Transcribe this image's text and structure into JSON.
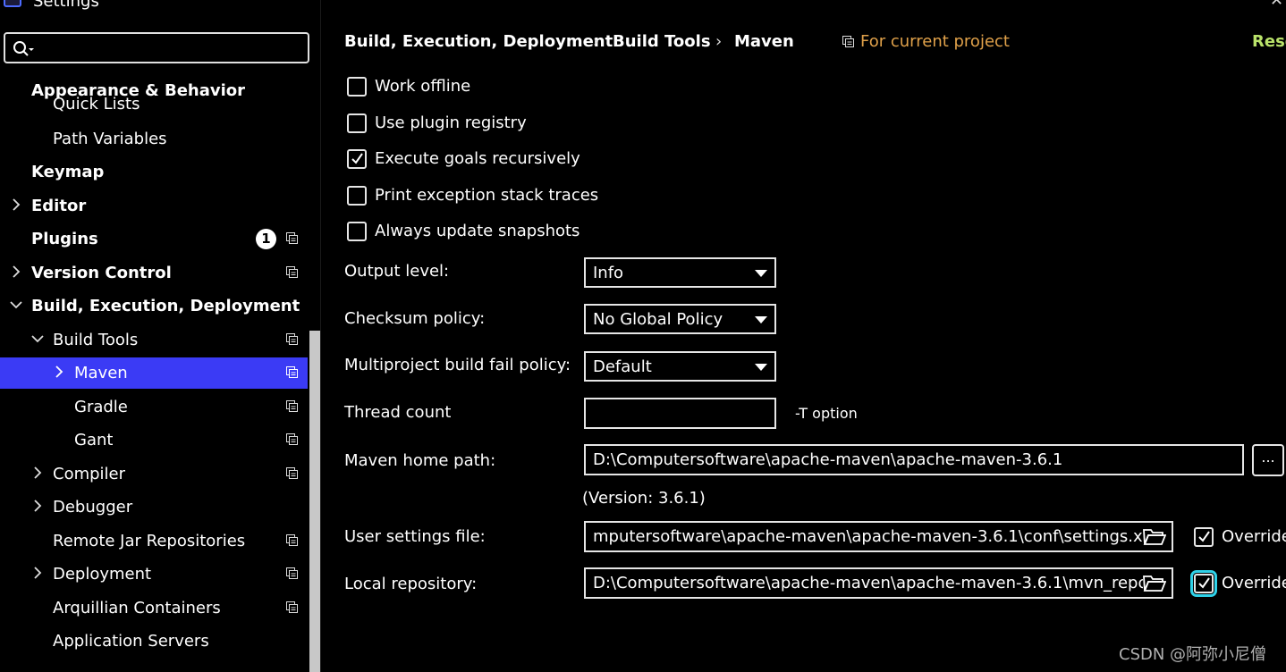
{
  "window": {
    "title": "Settings",
    "close_glyph": "✕"
  },
  "search": {
    "value": "",
    "placeholder": ""
  },
  "sidebar": {
    "items": [
      {
        "label": "Appearance & Behavior",
        "bold": true
      },
      {
        "label": "Quick Lists"
      },
      {
        "label": "Path Variables"
      },
      {
        "label": "Keymap",
        "bold": true
      },
      {
        "label": "Editor",
        "bold": true
      },
      {
        "label": "Plugins",
        "bold": true,
        "badge": "1"
      },
      {
        "label": "Version Control",
        "bold": true
      },
      {
        "label": "Build, Execution, Deployment",
        "bold": true
      },
      {
        "label": "Build Tools"
      },
      {
        "label": "Maven",
        "selected": true
      },
      {
        "label": "Gradle"
      },
      {
        "label": "Gant"
      },
      {
        "label": "Compiler"
      },
      {
        "label": "Debugger"
      },
      {
        "label": "Remote Jar Repositories"
      },
      {
        "label": "Deployment"
      },
      {
        "label": "Arquillian Containers"
      },
      {
        "label": "Application Servers"
      }
    ]
  },
  "breadcrumb": {
    "items": [
      "Build, Execution, Deployment",
      "Build Tools",
      "Maven"
    ],
    "separator": "›",
    "scope": "For current project",
    "reset": "Reset"
  },
  "options": {
    "work_offline": {
      "label": "Work offline",
      "checked": false
    },
    "plugin_registry": {
      "label": "Use plugin registry",
      "checked": false
    },
    "goals_recursive": {
      "label": "Execute goals recursively",
      "checked": true
    },
    "stack_traces": {
      "label": "Print exception stack traces",
      "checked": false
    },
    "update_snapshots": {
      "label": "Always update snapshots",
      "checked": false
    }
  },
  "fields": {
    "output_level": {
      "label": "Output level:",
      "value": "Info"
    },
    "checksum_policy": {
      "label": "Checksum policy:",
      "value": "No Global Policy"
    },
    "fail_policy": {
      "label": "Multiproject build fail policy:",
      "value": "Default"
    },
    "thread_count": {
      "label": "Thread count",
      "value": "",
      "hint": "-T option"
    },
    "maven_home": {
      "label": "Maven home path:",
      "value": "D:\\Computersoftware\\apache-maven\\apache-maven-3.6.1",
      "version": "(Version: 3.6.1)",
      "browse": "..."
    },
    "user_settings": {
      "label": "User settings file:",
      "value": "mputersoftware\\apache-maven\\apache-maven-3.6.1\\conf\\settings.xml",
      "override_label": "Override",
      "override": true
    },
    "local_repo": {
      "label": "Local repository:",
      "value": "D:\\Computersoftware\\apache-maven\\apache-maven-3.6.1\\mvn_repo",
      "override_label": "Override",
      "override": true
    }
  },
  "watermark": "CSDN @阿弥小尼僧",
  "colors": {
    "selection": "#3b3bf5",
    "scope": "#e0a14a",
    "reset": "#b9e26a",
    "focus": "#2fd1e8"
  }
}
